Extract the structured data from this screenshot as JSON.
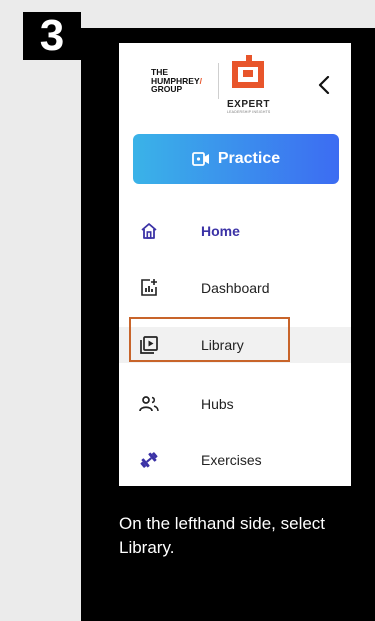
{
  "step": {
    "number": "3"
  },
  "logo": {
    "line1": "THE",
    "line2": "HUMPHREY",
    "slash": "/",
    "line3": "GROUP",
    "product": "EXPERT",
    "tagline": "LEADERSHIP INSIGHTS"
  },
  "sidebar": {
    "collapse_icon": "chevron-left-icon",
    "practice": {
      "label": "Practice",
      "icon": "video-icon"
    },
    "items": [
      {
        "label": "Home",
        "icon": "home-icon",
        "active": true
      },
      {
        "label": "Dashboard",
        "icon": "dashboard-icon",
        "active": false
      },
      {
        "label": "Library",
        "icon": "library-icon",
        "active": false,
        "highlighted": true
      },
      {
        "label": "Hubs",
        "icon": "people-icon",
        "active": false
      },
      {
        "label": "Exercises",
        "icon": "dumbbell-icon",
        "active": false
      }
    ]
  },
  "instruction": "On the lefthand side, select Library.",
  "colors": {
    "accent": "#3b32a6",
    "practice_gradient_start": "#3ab3e8",
    "practice_gradient_end": "#3c6cf2",
    "highlight_border": "#c8642a",
    "panel": "#000000",
    "page_background": "#ebebeb"
  }
}
